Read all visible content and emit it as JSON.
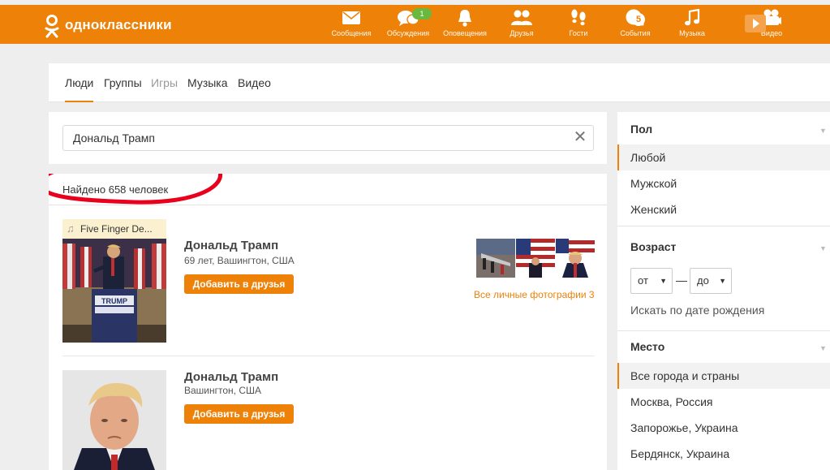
{
  "header": {
    "logo_text": "одноклассники",
    "nav": [
      {
        "label": "Сообщения",
        "icon": "envelope-icon"
      },
      {
        "label": "Обсуждения",
        "icon": "chat-bubbles-icon",
        "badge": "1"
      },
      {
        "label": "Оповещения",
        "icon": "bell-icon"
      },
      {
        "label": "Друзья",
        "icon": "people-icon"
      },
      {
        "label": "Гости",
        "icon": "footprints-icon"
      },
      {
        "label": "События",
        "icon": "events-icon",
        "badge": "5"
      },
      {
        "label": "Музыка",
        "icon": "music-note-icon"
      },
      {
        "label": "Видео",
        "icon": "video-camera-icon"
      }
    ]
  },
  "tabs": [
    {
      "label": "Люди",
      "active": true
    },
    {
      "label": "Группы"
    },
    {
      "label": "Игры",
      "muted": true
    },
    {
      "label": "Музыка"
    },
    {
      "label": "Видео"
    }
  ],
  "search": {
    "value": "Дональд Трамп"
  },
  "results": {
    "found_text": "Найдено 658 человек",
    "people": [
      {
        "name": "Дональд Трамп",
        "meta": "69 лет, Вашингтон, США",
        "add_label": "Добавить в друзья",
        "music_tag": "Five Finger De...",
        "all_photos": "Все личные фотографии 3"
      },
      {
        "name": "Дональд Трамп",
        "meta": "Вашингтон, США",
        "add_label": "Добавить в друзья"
      }
    ]
  },
  "filters": {
    "gender": {
      "title": "Пол",
      "options": [
        "Любой",
        "Мужской",
        "Женский"
      ],
      "selected": "Любой"
    },
    "age": {
      "title": "Возраст",
      "from_label": "от",
      "dash": "—",
      "to_label": "до",
      "bday_link": "Искать по дате рождения"
    },
    "place": {
      "title": "Место",
      "options": [
        "Все города и страны",
        "Москва, Россия",
        "Запорожье, Украина",
        "Бердянск, Украина"
      ],
      "selected": "Все города и страны"
    }
  },
  "colors": {
    "accent": "#ee8208",
    "badge_green": "#6ab93d",
    "annotation_red": "#e8001c"
  }
}
